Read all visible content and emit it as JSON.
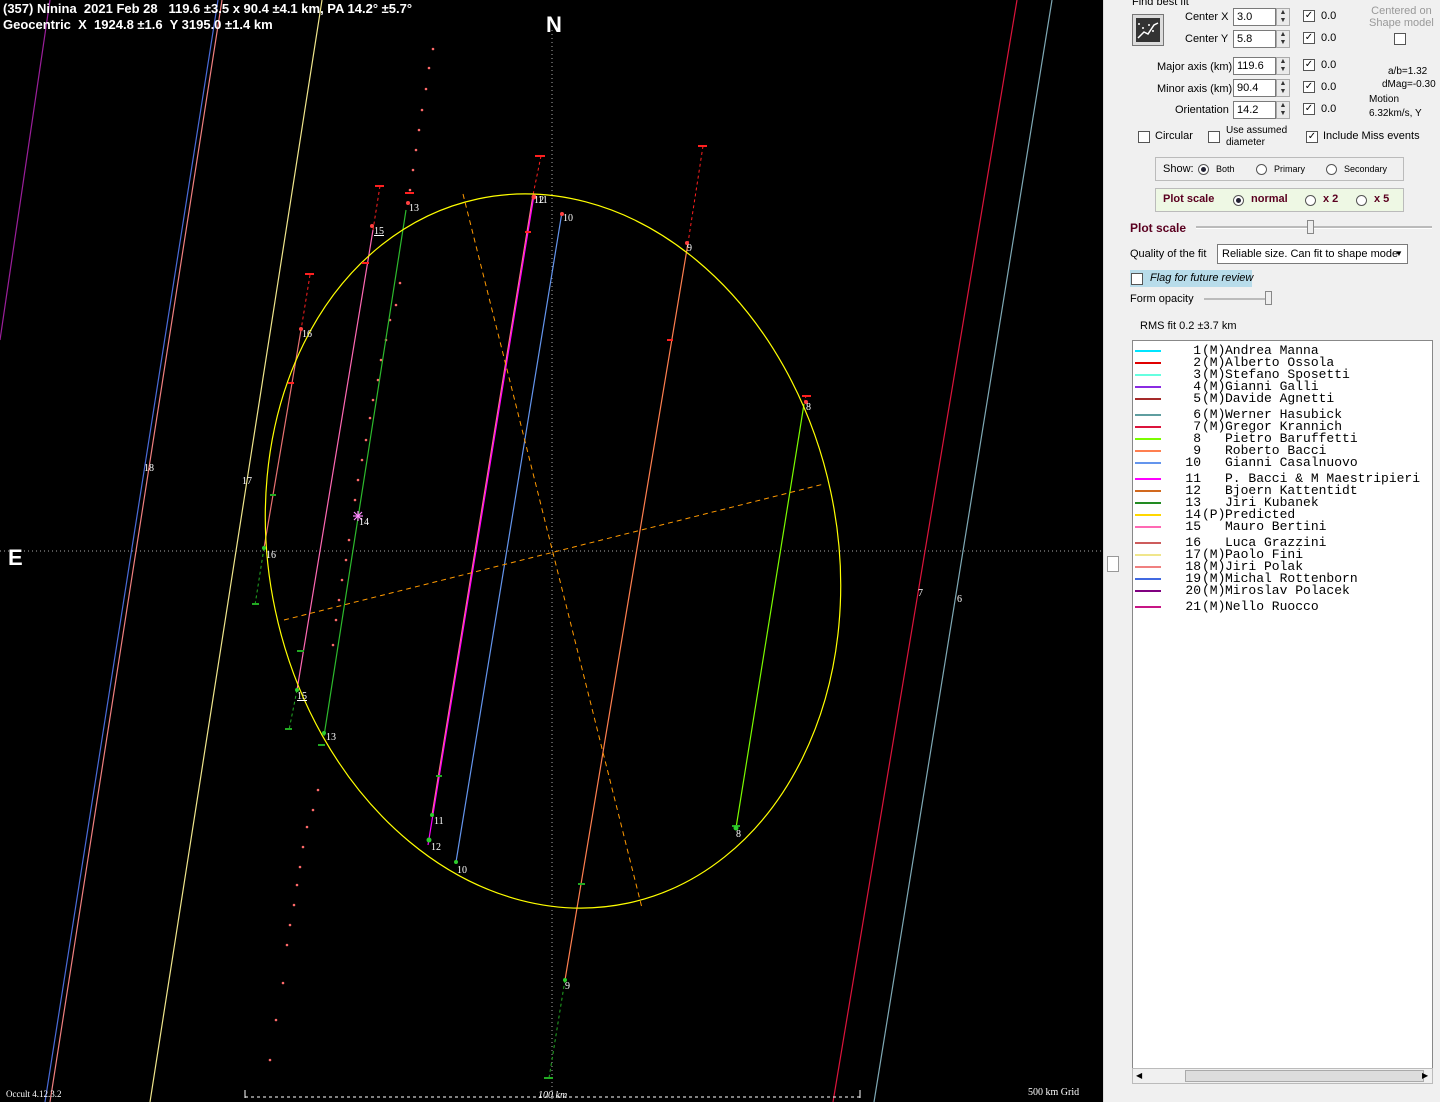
{
  "plot": {
    "header_line1": "(357) Ninina  2021 Feb 28   119.6 ±3.5 x 90.4 ±4.1 km, PA 14.2° ±5.7°",
    "header_line2": "Geocentric  X  1924.8 ±1.6  Y 3195.0 ±1.4 km",
    "north_label": "N",
    "east_label": "E",
    "version": "Occult 4.12.3.2",
    "scale_bar_label": "100 km",
    "grid_label": "500 km Grid",
    "chord_labels": [
      "18",
      "17",
      "16",
      "16",
      "15",
      "15",
      "14",
      "13",
      "13",
      "12",
      "11",
      "12",
      "11",
      "10",
      "10",
      "9",
      "9",
      "8",
      "8",
      "7",
      "6"
    ]
  },
  "panel": {
    "find_best_fit": "Find best fit",
    "centered_label": "Centered on\nShape model",
    "center_x_label": "Center X",
    "center_x_value": "3.0",
    "center_x_step": "0.0",
    "center_y_label": "Center Y",
    "center_y_value": "5.8",
    "center_y_step": "0.0",
    "major_label": "Major axis (km)",
    "major_value": "119.6",
    "major_step": "0.0",
    "minor_label": "Minor axis (km)",
    "minor_value": "90.4",
    "minor_step": "0.0",
    "orientation_label": "Orientation",
    "orientation_value": "14.2",
    "orientation_step": "0.0",
    "ab_ratio": "a/b=1.32",
    "dmag": "dMag=-0.30",
    "motion_label": "Motion",
    "motion_value": "6.32km/s, Y",
    "circular_label": "Circular",
    "assumed_label": "Use assumed\ndiameter",
    "miss_label": "Include Miss events",
    "show_label": "Show:",
    "show_both": "Both",
    "show_primary": "Primary",
    "show_secondary": "Secondary",
    "plot_scale_box_label": "Plot scale",
    "scale_normal": "normal",
    "scale_x2": "x 2",
    "scale_x5": "x 5",
    "plot_scale_slider_label": "Plot scale",
    "quality_label": "Quality of the fit",
    "quality_value": "Reliable size. Can fit to shape mode",
    "flag_label": "Flag for future review",
    "form_opacity_label": "Form opacity",
    "rms_label": "RMS fit 0.2 ±3.7 km"
  },
  "legend": [
    {
      "num": "1",
      "tag": "(M)",
      "name": "Andrea Manna",
      "color": "#00e5ff"
    },
    {
      "num": "2",
      "tag": "(M)",
      "name": "Alberto Ossola",
      "color": "#e00000"
    },
    {
      "num": "3",
      "tag": "(M)",
      "name": "Stefano Sposetti",
      "color": "#66ffe0"
    },
    {
      "num": "4",
      "tag": "(M)",
      "name": "Gianni Galli",
      "color": "#8a2be2"
    },
    {
      "num": "5",
      "tag": "(M)",
      "name": "Davide Agnetti",
      "color": "#a52a2a"
    },
    {
      "num": "6",
      "tag": "(M)",
      "name": "Werner Hasubick",
      "color": "#5f9ea0"
    },
    {
      "num": "7",
      "tag": "(M)",
      "name": "Gregor Krannich",
      "color": "#dc143c"
    },
    {
      "num": "8",
      "tag": "",
      "name": "Pietro Baruffetti",
      "color": "#7cfc00"
    },
    {
      "num": "9",
      "tag": "",
      "name": "Roberto Bacci",
      "color": "#ff7f50"
    },
    {
      "num": "10",
      "tag": "",
      "name": "Gianni Casalnuovo",
      "color": "#6495ed"
    },
    {
      "num": "11",
      "tag": "",
      "name": "P. Bacci & M Maestripieri",
      "color": "#ff00ff"
    },
    {
      "num": "12",
      "tag": "",
      "name": "Bjoern Kattentidt",
      "color": "#d2691e"
    },
    {
      "num": "13",
      "tag": "",
      "name": "Jiri Kubanek",
      "color": "#228b22"
    },
    {
      "num": "14",
      "tag": "(P)",
      "name": "Predicted",
      "color": "#ffd700"
    },
    {
      "num": "15",
      "tag": "",
      "name": "Mauro Bertini",
      "color": "#ff69b4"
    },
    {
      "num": "16",
      "tag": "",
      "name": "Luca Grazzini",
      "color": "#cd5c5c"
    },
    {
      "num": "17",
      "tag": "(M)",
      "name": "Paolo Fini",
      "color": "#f0e68c"
    },
    {
      "num": "18",
      "tag": "(M)",
      "name": "Jiri Polak",
      "color": "#f08080"
    },
    {
      "num": "19",
      "tag": "(M)",
      "name": "Michal Rottenborn",
      "color": "#4169e1"
    },
    {
      "num": "20",
      "tag": "(M)",
      "name": "Miroslav Polacek",
      "color": "#800080"
    },
    {
      "num": "21",
      "tag": "(M)",
      "name": "Nello Ruocco",
      "color": "#c71585"
    }
  ],
  "colors": {
    "ellipse": "#ffff00",
    "axes_dashed": "#ff9900",
    "disappear": "#ff2020",
    "reappear": "#22aa22",
    "panel_bg": "#f0f0f0",
    "flag_bg": "#b8dcea"
  }
}
